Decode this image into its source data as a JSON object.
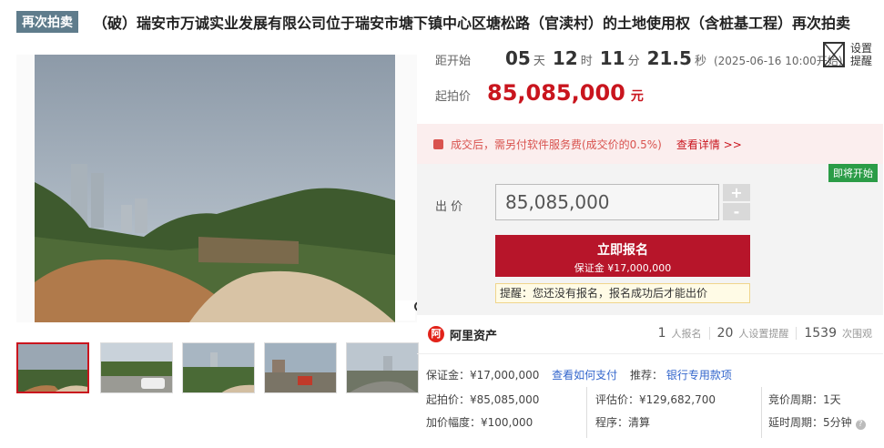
{
  "title_bar": {
    "tag": "再次拍卖",
    "title": "（破）瑞安市万诚实业发展有限公司位于瑞安市塘下镇中心区塘松路（官渎村）的土地使用权（含桩基工程）再次拍卖"
  },
  "countdown": {
    "label": "距开始",
    "days": "05",
    "days_unit": "天",
    "hours": "12",
    "hours_unit": "时",
    "minutes": "11",
    "minutes_unit": "分",
    "seconds": "21.5",
    "seconds_unit": "秒",
    "start_time": "(2025-06-16 10:00开始)"
  },
  "remind": {
    "label_line1": "设置",
    "label_line2": "提醒"
  },
  "start_price": {
    "label": "起拍价",
    "value": "85,085,000",
    "unit": "元"
  },
  "fee_notice": {
    "text": "成交后，需另付软件服务费(成交价的0.5%)",
    "link": "查看详情 >>"
  },
  "bid": {
    "status_badge": "即将开始",
    "label": "出 价",
    "value": "85,085,000",
    "plus": "+",
    "minus": "-",
    "signup_label": "立即报名",
    "deposit_label": "保证金 ¥17,000,000",
    "tip": "提醒：您还没有报名，报名成功后才能出价"
  },
  "platform": {
    "logo_char": "阿",
    "name": "阿里资产",
    "signups": "1",
    "signups_label": "人报名",
    "reminders": "20",
    "reminders_label": "人设置提醒",
    "views": "1539",
    "views_label": "次围观"
  },
  "details": {
    "deposit": "保证金：¥17,000,000",
    "deposit_link": "查看如何支付",
    "recommend_label": "推荐：",
    "recommend_link": "银行专用款项",
    "start_price": "起拍价：¥85,085,000",
    "appraisal": "评估价：¥129,682,700",
    "cycle": "竞价周期：1天",
    "increment": "加价幅度：¥100,000",
    "procedure": "程序：清算",
    "delay": "延时周期：5分钟"
  },
  "colors": {
    "accent_red": "#c9151e",
    "button_red": "#b7152a",
    "green_badge": "#2b9c47",
    "tag_gray": "#5f7c8c",
    "link_blue": "#3366cc"
  },
  "icons": [
    "magnifier-icon",
    "remind-image-icon",
    "fee-bag-icon",
    "alibaba-logo-icon",
    "help-icon"
  ]
}
